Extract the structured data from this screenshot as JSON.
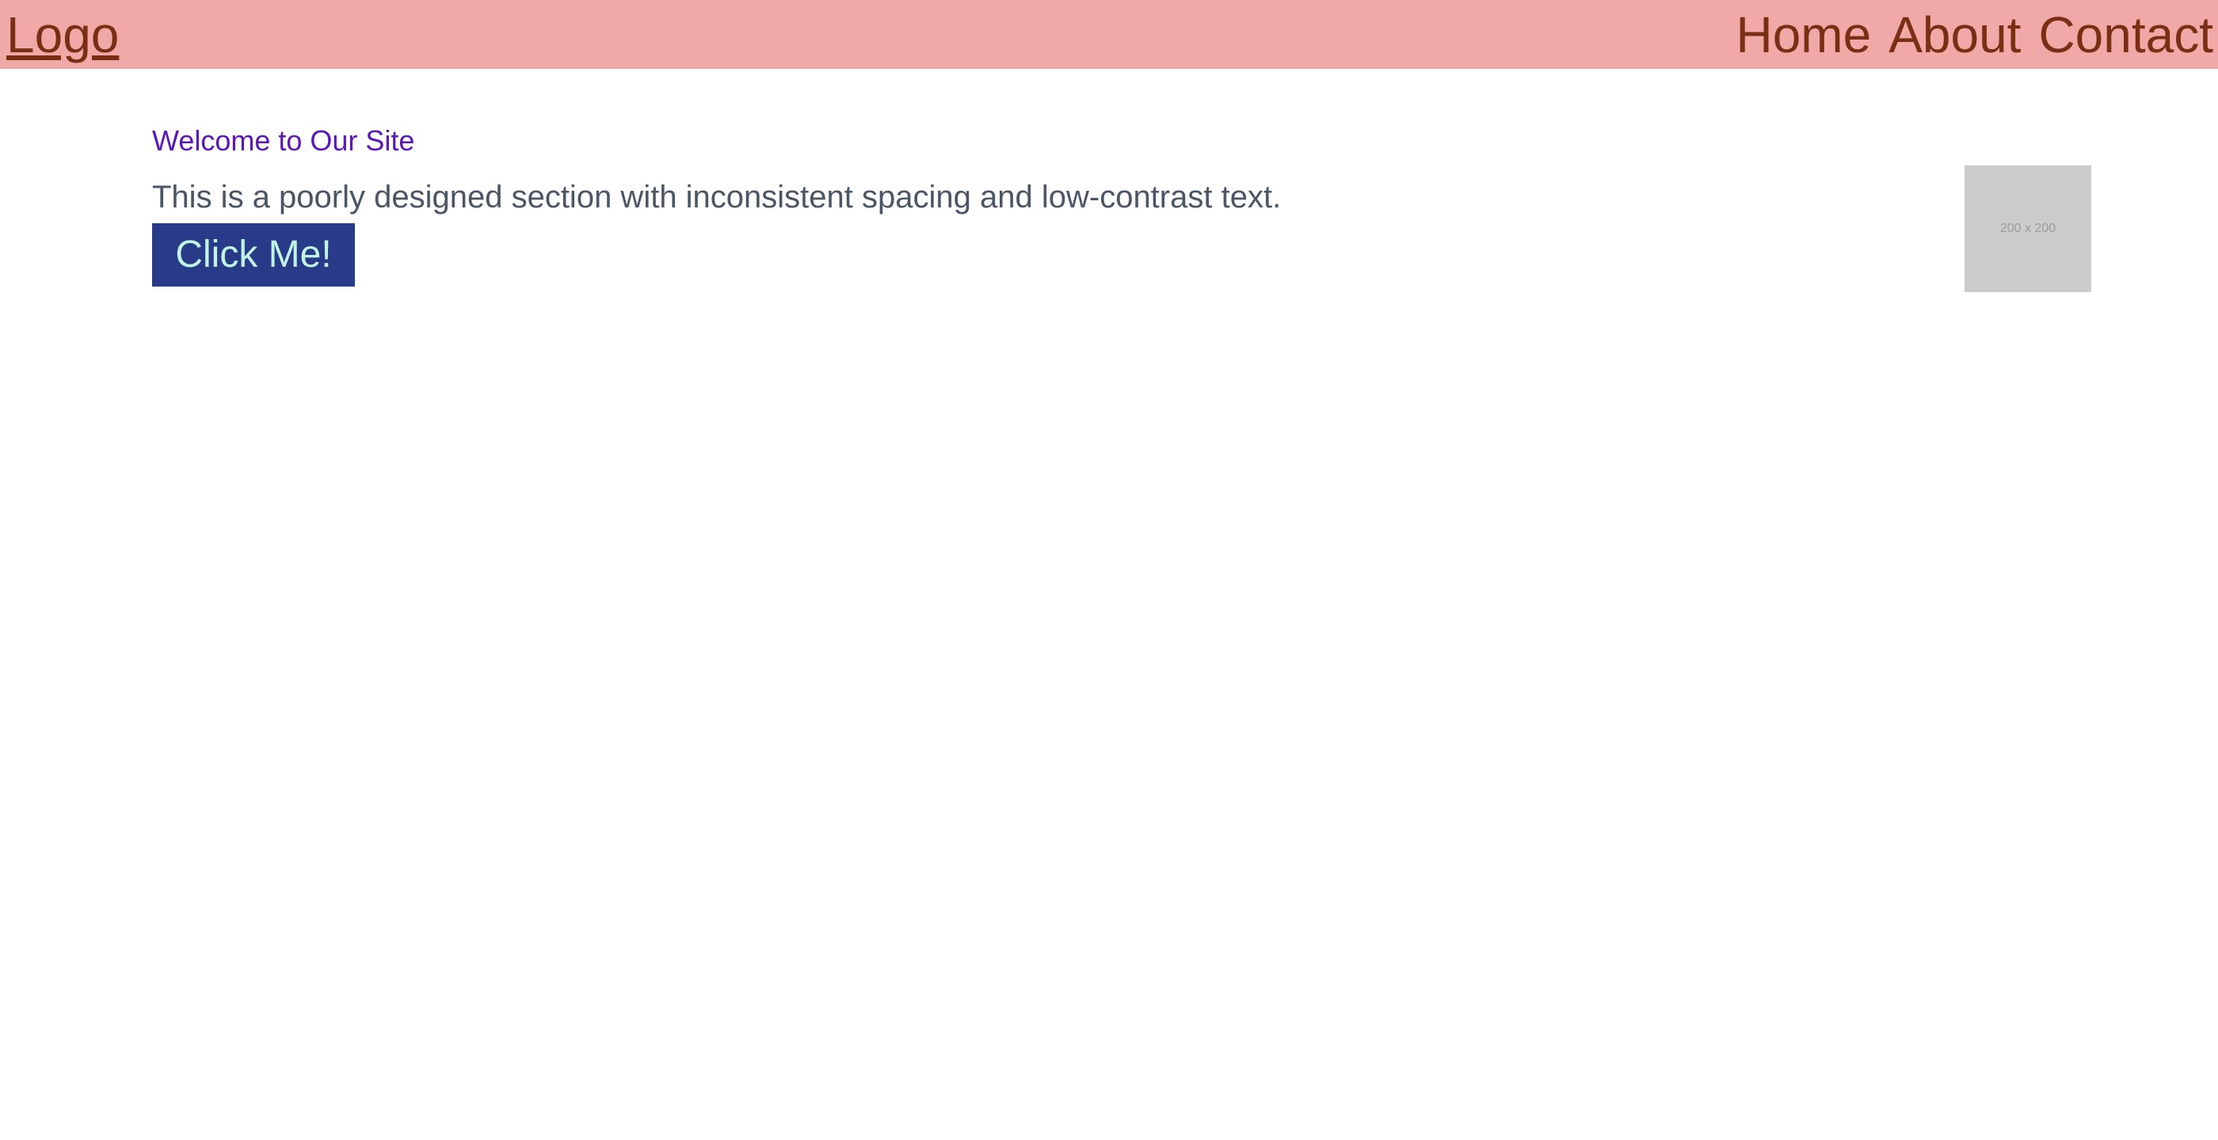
{
  "header": {
    "logo": "Logo",
    "nav": [
      {
        "label": "Home"
      },
      {
        "label": "About"
      },
      {
        "label": "Contact"
      }
    ],
    "background_color": "#f1a9a7",
    "text_color": "#7a2e13"
  },
  "main": {
    "title": "Welcome to Our Site",
    "description": "This is a poorly designed section with inconsistent spacing and low-contrast text.",
    "button_label": "Click Me!",
    "image_placeholder_text": "200 x 200",
    "title_color": "#5b16b7",
    "text_color": "#4a5565",
    "button_background": "#293a88",
    "button_text_color": "#bff5e2",
    "image_background": "#cccccc"
  }
}
